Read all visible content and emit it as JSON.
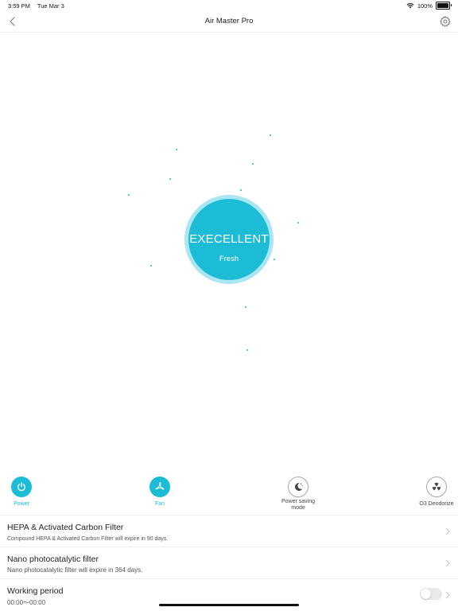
{
  "status_bar": {
    "time": "3:59 PM",
    "date": "Tue Mar 3",
    "battery_percent": "100%",
    "battery_level": 1.0,
    "wifi_icon": "wifi-icon",
    "battery_icon": "battery-icon"
  },
  "nav": {
    "title": "Air Master Pro",
    "back_icon": "chevron-left-icon",
    "settings_icon": "gear-icon"
  },
  "air_quality": {
    "level": "EXECELLENT",
    "description": "Fresh",
    "accent_color": "#1cbcd6",
    "halo_color": "#a9e6f2"
  },
  "controls": [
    {
      "label": "Power",
      "icon": "power-icon",
      "active": true
    },
    {
      "label": "Fan",
      "icon": "fan-icon",
      "active": true
    },
    {
      "label": "Power saving mode",
      "icon": "moon-icon",
      "active": false
    },
    {
      "label": "O3 Deodorize",
      "icon": "deodorize-icon",
      "active": false
    }
  ],
  "settings_list": [
    {
      "title": "HEPA & Activated Carbon Filter",
      "subtitle": "Compound HEPA & Activated Carbon Filter will expire in 90 days."
    },
    {
      "title": "Nano photocatalytic filter",
      "subtitle": "Nano photocatalytic filter will expire in 364 days."
    },
    {
      "title": "Working period",
      "subtitle": "00:00～00:00",
      "toggle_on": false
    }
  ]
}
